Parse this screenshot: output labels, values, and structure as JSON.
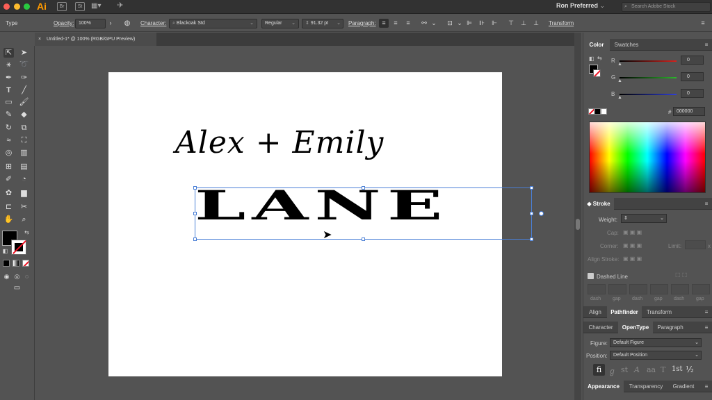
{
  "titlebar": {
    "app_logo": "Ai",
    "bridge_icon": "Br",
    "stock_icon": "St",
    "workspace": "Ron Preferred",
    "search_placeholder": "Search Adobe Stock"
  },
  "control_bar": {
    "mode": "Type",
    "opacity_label": "Opacity:",
    "opacity_value": "100%",
    "character_label": "Character:",
    "font_family": "Blackoak Std",
    "font_style": "Regular",
    "font_size": "91.32 pt",
    "paragraph_label": "Paragraph:",
    "transform_label": "Transform"
  },
  "document": {
    "tab_title": "Untitled-1* @ 100% (RGB/GPU Preview)",
    "script_text": "Alex + Emily",
    "main_text": "LANE"
  },
  "color_panel": {
    "tab_color": "Color",
    "tab_swatches": "Swatches",
    "r_label": "R",
    "g_label": "G",
    "b_label": "B",
    "r_value": "0",
    "g_value": "0",
    "b_value": "0",
    "hash": "#",
    "hex_value": "000000",
    "r_color": "#d8221d",
    "g_color": "#2db52d",
    "b_color": "#2f3fd8"
  },
  "stroke_panel": {
    "title": "Stroke",
    "weight_label": "Weight:",
    "cap_label": "Cap:",
    "corner_label": "Corner:",
    "limit_label": "Limit:",
    "limit_x": "x",
    "align_label": "Align Stroke:",
    "dashed_line_label": "Dashed Line",
    "dash_labels": [
      "dash",
      "gap",
      "dash",
      "gap",
      "dash",
      "gap"
    ]
  },
  "align_group": {
    "tabs": [
      "Align",
      "Pathfinder",
      "Transform"
    ]
  },
  "opentype_group": {
    "tabs": [
      "Character",
      "OpenType",
      "Paragraph"
    ],
    "figure_label": "Figure:",
    "figure_value": "Default Figure",
    "position_label": "Position:",
    "position_value": "Default Position",
    "glyph_buttons": [
      "fi",
      "ℊ",
      "st",
      "A",
      "aa",
      "T",
      "1st",
      "½"
    ]
  },
  "appearance_group": {
    "tabs": [
      "Appearance",
      "Transparency",
      "Gradient"
    ]
  }
}
